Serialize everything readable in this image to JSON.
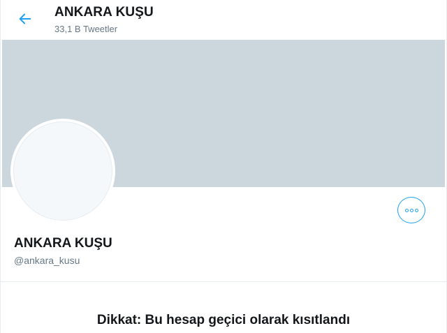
{
  "header": {
    "title": "ANKARA KUŞU",
    "subtitle": "33,1 B Tweetler",
    "back_icon": "arrow-left-icon"
  },
  "profile": {
    "name": "ANKARA KUŞU",
    "handle": "@ankara_kusu",
    "more_icon": "more-icon"
  },
  "notice": {
    "text": "Dikkat: Bu hesap geçici olarak kısıtlandı"
  },
  "colors": {
    "accent": "#1da1f2",
    "banner": "#ccd6dd",
    "text_primary": "#14171a",
    "text_secondary": "#657786"
  }
}
